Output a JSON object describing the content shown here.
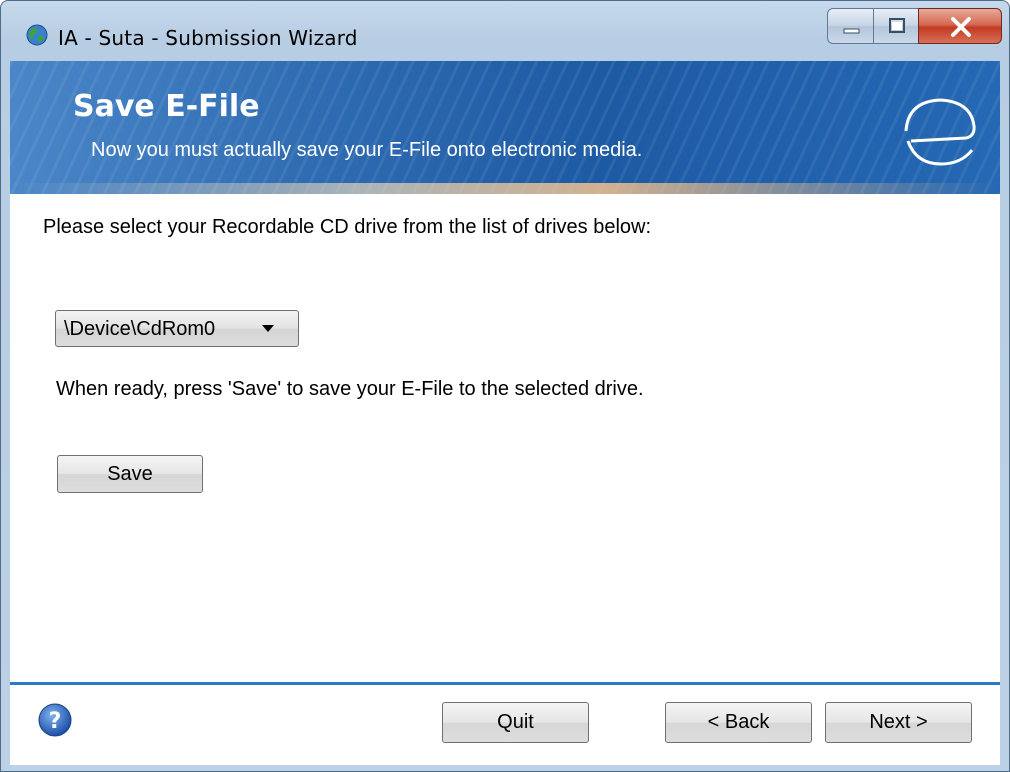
{
  "window": {
    "title": "IA - Suta - Submission Wizard",
    "icons": {
      "app": "globe-icon",
      "minimize": "minimize-icon",
      "maximize": "maximize-icon",
      "close": "close-icon"
    }
  },
  "banner": {
    "title": "Save E-File",
    "subtitle": "Now you must actually save your E-File onto electronic media.",
    "logo": "e-logo-icon"
  },
  "main": {
    "prompt": "Please select your Recordable CD drive from the list of drives below:",
    "drive_select": {
      "value": "\\Device\\CdRom0"
    },
    "hint": "When ready, press 'Save' to save your E-File to the selected drive.",
    "save_label": "Save"
  },
  "footer": {
    "help_icon": "help-icon",
    "quit_label": "Quit",
    "back_label": "< Back",
    "next_label": "Next >"
  },
  "colors": {
    "banner_blue": "#1d5aa4",
    "footer_line": "#2a7bc8",
    "close_red": "#c23b22"
  }
}
